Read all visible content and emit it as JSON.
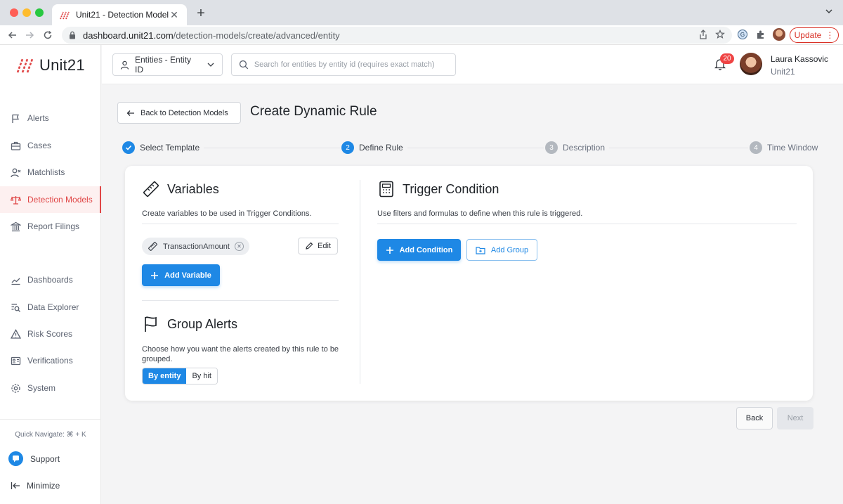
{
  "browser": {
    "tab_title": "Unit21 - Detection Models",
    "url_host": "dashboard.unit21.com",
    "url_path": "/detection-models/create/advanced/entity",
    "update_label": "Update"
  },
  "sidebar": {
    "brand": "Unit21",
    "items": [
      {
        "label": "Alerts",
        "icon": "flag-icon"
      },
      {
        "label": "Cases",
        "icon": "briefcase-icon"
      },
      {
        "label": "Matchlists",
        "icon": "user-x-icon"
      },
      {
        "label": "Detection Models",
        "icon": "scale-icon",
        "active": true
      },
      {
        "label": "Report Filings",
        "icon": "bank-icon"
      },
      {
        "label": "Dashboards",
        "icon": "chart-line-icon"
      },
      {
        "label": "Data Explorer",
        "icon": "list-search-icon"
      },
      {
        "label": "Risk Scores",
        "icon": "warning-triangle-icon"
      },
      {
        "label": "Verifications",
        "icon": "id-card-icon"
      },
      {
        "label": "System",
        "icon": "gear-icon"
      }
    ],
    "quick_navigate": "Quick Navigate: ⌘ + K",
    "support": "Support",
    "minimize": "Minimize"
  },
  "header": {
    "entity_select": "Entities - Entity ID",
    "search_placeholder": "Search for entities by entity id (requires exact match)",
    "notification_count": "20",
    "user_name": "Laura Kassovic",
    "user_org": "Unit21"
  },
  "main": {
    "back_label": "Back to Detection Models",
    "title": "Create Dynamic Rule",
    "steps": [
      {
        "number": "1",
        "label": "Select Template",
        "state": "done"
      },
      {
        "number": "2",
        "label": "Define Rule",
        "state": "current"
      },
      {
        "number": "3",
        "label": "Description",
        "state": "future"
      },
      {
        "number": "4",
        "label": "Time Window",
        "state": "future"
      }
    ],
    "variables": {
      "title": "Variables",
      "description": "Create variables to be used in Trigger Conditions.",
      "chip": "TransactionAmount",
      "edit": "Edit",
      "add": "Add Variable"
    },
    "group_alerts": {
      "title": "Group Alerts",
      "description": "Choose how you want the alerts created by this rule to be grouped.",
      "options": [
        "By entity",
        "By hit"
      ],
      "selected": "By entity"
    },
    "trigger": {
      "title": "Trigger Condition",
      "description": "Use filters and formulas to define when this rule is triggered.",
      "add_condition": "Add Condition",
      "add_group": "Add Group"
    },
    "footer": {
      "back": "Back",
      "next": "Next"
    }
  },
  "colors": {
    "accent": "#1e88e5",
    "active_nav": "#e04646",
    "badge": "#ef4444"
  }
}
